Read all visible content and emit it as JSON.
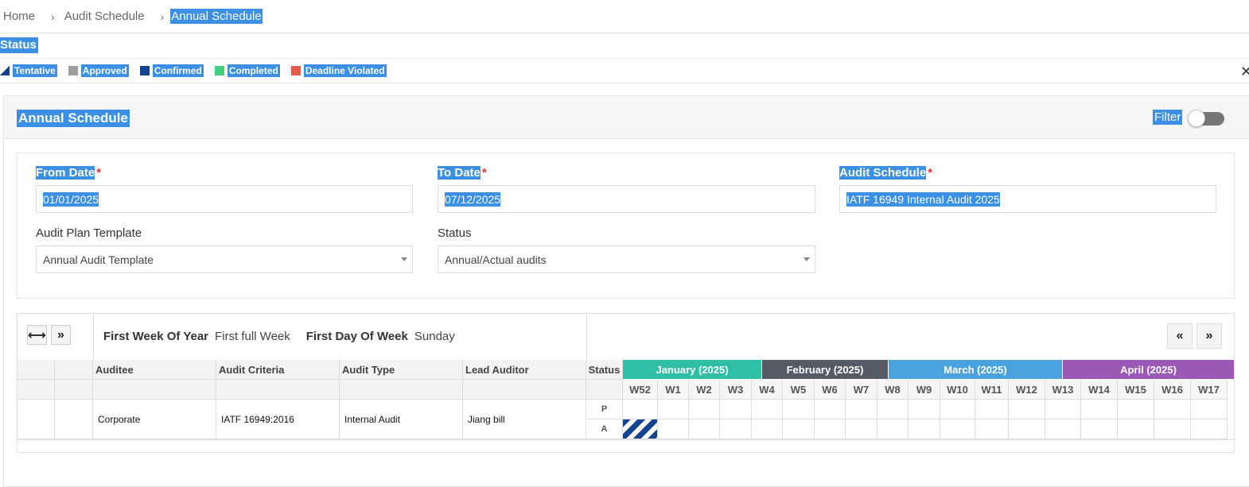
{
  "breadcrumb": {
    "home": "Home",
    "audit_schedule": "Audit Schedule",
    "current": "Annual Schedule"
  },
  "status_legend": {
    "title": "Status",
    "items": [
      {
        "label": "Tentative",
        "color": "#14438f"
      },
      {
        "label": "Approved",
        "color": "#9e9e9e"
      },
      {
        "label": "Confirmed",
        "color": "#14438f"
      },
      {
        "label": "Completed",
        "color": "#3fcf7f"
      },
      {
        "label": "Deadline Violated",
        "color": "#e8594e"
      }
    ],
    "close_icon": "close-icon"
  },
  "panel": {
    "title": "Annual Schedule",
    "filter_label": "Filter",
    "filter_on": false
  },
  "form": {
    "from_date": {
      "label": "From Date",
      "value": "01/01/2025"
    },
    "to_date": {
      "label": "To Date",
      "value": "07/12/2025"
    },
    "audit_schedule": {
      "label": "Audit Schedule",
      "value": "IATF 16949 Internal Audit 2025"
    },
    "audit_plan_template": {
      "label": "Audit Plan Template",
      "value": "Annual Audit Template"
    },
    "status": {
      "label": "Status",
      "value": "Annual/Actual audits"
    }
  },
  "grid": {
    "first_week_label": "First Week Of Year",
    "first_week_value": "First full Week",
    "first_day_label": "First Day Of Week",
    "first_day_value": "Sunday",
    "columns": [
      "Auditee",
      "Audit Criteria",
      "Audit Type",
      "Lead Auditor",
      "Status"
    ],
    "months": [
      {
        "label": "January (2025)",
        "color": "#2fbfa6",
        "weeks": 5
      },
      {
        "label": "February (2025)",
        "color": "#545b66",
        "weeks": 4
      },
      {
        "label": "March (2025)",
        "color": "#4aa3df",
        "weeks": 5
      },
      {
        "label": "April (2025)",
        "color": "#9b59b6",
        "weeks": 5
      }
    ],
    "weeks": [
      "W52",
      "W1",
      "W2",
      "W3",
      "W4",
      "W5",
      "W6",
      "W7",
      "W8",
      "W9",
      "W10",
      "W11",
      "W12",
      "W13",
      "W14",
      "W15",
      "W16",
      "W17"
    ],
    "rows": [
      {
        "auditee": "Corporate",
        "criteria": "IATF 16949:2016",
        "type": "Internal Audit",
        "lead": "Jiang bill",
        "plan_label": "P",
        "actual_label": "A",
        "actual_tentative_week": "W52"
      }
    ]
  }
}
